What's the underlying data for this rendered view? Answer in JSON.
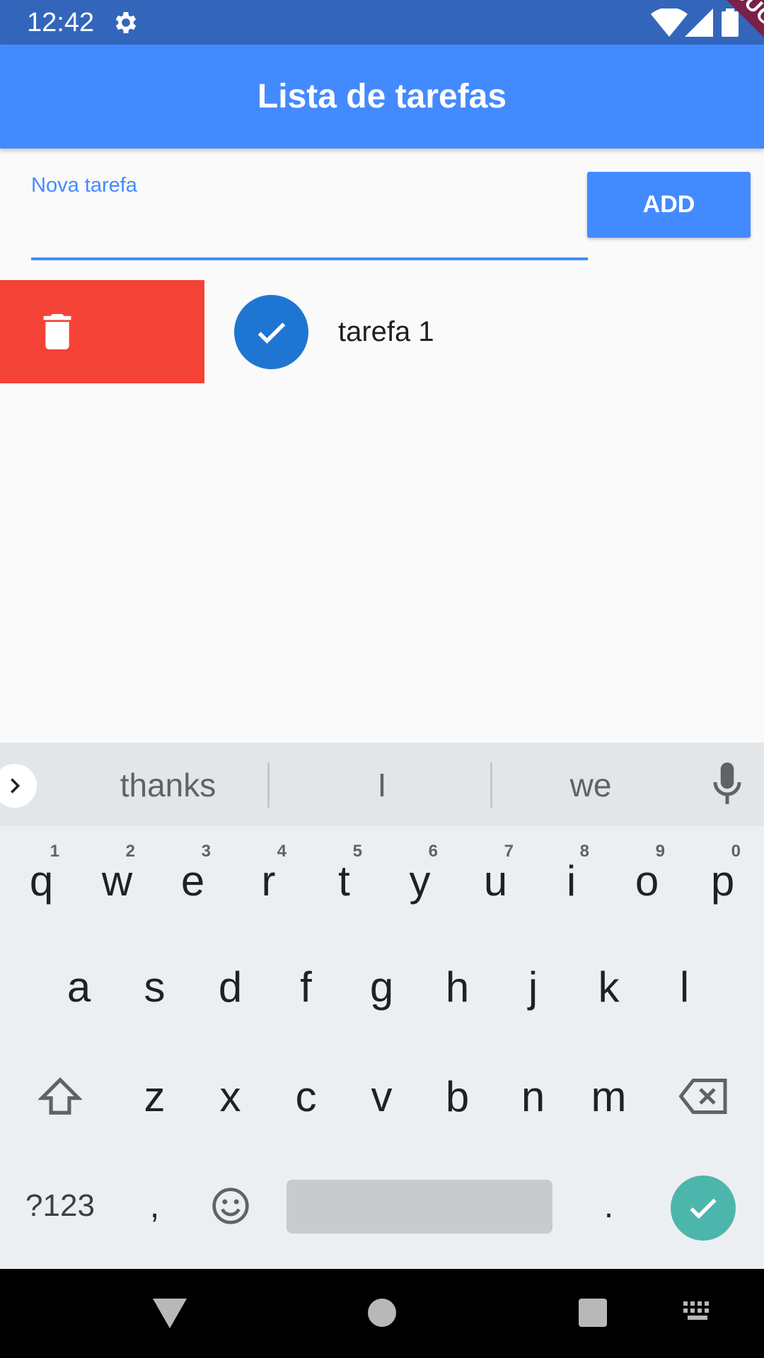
{
  "status_bar": {
    "time": "12:42"
  },
  "app_bar": {
    "title": "Lista de tarefas"
  },
  "debug_banner": "DEBUG",
  "input": {
    "label": "Nova tarefa",
    "value": ""
  },
  "add_button": {
    "label": "ADD"
  },
  "tasks": [
    {
      "title": "tarefa 1",
      "done": true
    }
  ],
  "colors": {
    "primary": "#448aff",
    "status_bar": "#3366bb",
    "delete": "#f44336",
    "check": "#1e76d2",
    "enter": "#4db6ac"
  },
  "keyboard": {
    "suggestions": [
      "thanks",
      "I",
      "we"
    ],
    "row1": [
      "q",
      "w",
      "e",
      "r",
      "t",
      "y",
      "u",
      "i",
      "o",
      "p"
    ],
    "row1_hints": [
      "1",
      "2",
      "3",
      "4",
      "5",
      "6",
      "7",
      "8",
      "9",
      "0"
    ],
    "row2": [
      "a",
      "s",
      "d",
      "f",
      "g",
      "h",
      "j",
      "k",
      "l"
    ],
    "row3": [
      "z",
      "x",
      "c",
      "v",
      "b",
      "n",
      "m"
    ],
    "symbols_label": "?123",
    "comma": ",",
    "period": "."
  }
}
